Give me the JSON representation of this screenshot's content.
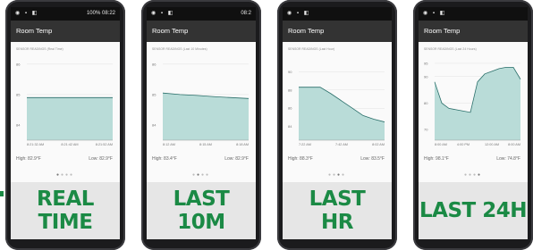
{
  "accent_color": "#1b8a45",
  "fill_color": "#b9dcd8",
  "phones": [
    {
      "status_right": "100% 08:22",
      "app_title": "Room Temp",
      "sensor_label": "SENSOR READINGS (Real Time)",
      "high": "High: 82.9°F",
      "low": "Low: 82.9°F",
      "caption": [
        "REAL",
        "TIME"
      ],
      "active_dot": 0,
      "chart_data": {
        "type": "area",
        "x_ticks": [
          "8:21:32 AM",
          "8:21:42 AM",
          "8:21:52 AM"
        ],
        "y_ticks": [
          84,
          85,
          86
        ],
        "ylim": [
          83.5,
          86.2
        ],
        "points": [
          [
            0,
            84.9
          ],
          [
            1,
            84.9
          ],
          [
            2,
            84.9
          ],
          [
            3,
            84.9
          ],
          [
            4,
            84.9
          ],
          [
            5,
            84.9
          ]
        ]
      }
    },
    {
      "status_right": "08:2",
      "app_title": "Room Temp",
      "sensor_label": "SENSOR READINGS (Last 10 Minutes)",
      "high": "High: 83.4°F",
      "low": "Low: 82.9°F",
      "caption": [
        "LAST",
        "10M"
      ],
      "active_dot": 1,
      "chart_data": {
        "type": "area",
        "x_ticks": [
          "8:12 AM",
          "8:15 AM",
          "8:18 AM"
        ],
        "y_ticks": [
          84,
          85,
          86
        ],
        "ylim": [
          83.5,
          86.2
        ],
        "points": [
          [
            0,
            85.05
          ],
          [
            1,
            85.0
          ],
          [
            2,
            84.97
          ],
          [
            3,
            84.93
          ],
          [
            4,
            84.9
          ],
          [
            5,
            84.87
          ]
        ]
      }
    },
    {
      "status_right": "",
      "app_title": "Room Temp",
      "sensor_label": "SENSOR READINGS (Last Hour)",
      "high": "High: 88.3°F",
      "low": "Low: 83.5°F",
      "caption": [
        "LAST",
        "HR"
      ],
      "active_dot": 2,
      "chart_data": {
        "type": "area",
        "x_ticks": [
          "7:22 AM",
          "7:42 AM",
          "8:02 AM"
        ],
        "y_ticks": [
          84,
          86,
          88,
          90
        ],
        "ylim": [
          82.5,
          91.5
        ],
        "points": [
          [
            0,
            88.3
          ],
          [
            1,
            88.3
          ],
          [
            2,
            88.3
          ],
          [
            3,
            87.6
          ],
          [
            4,
            86.8
          ],
          [
            5,
            86.0
          ],
          [
            6,
            85.2
          ],
          [
            7,
            84.8
          ],
          [
            8,
            84.5
          ]
        ]
      }
    },
    {
      "status_right": "",
      "app_title": "Room Temp",
      "sensor_label": "SENSOR READINGS (Last 24 Hours)",
      "high": "High: 98.1°F",
      "low": "Low: 74.8°F",
      "caption": [
        "LAST 24H"
      ],
      "active_dot": 3,
      "chart_data": {
        "type": "area",
        "x_ticks": [
          "8:00 AM",
          "4:00 PM",
          "12:00 AM",
          "8:00 AM"
        ],
        "y_ticks": [
          70,
          80,
          90,
          95
        ],
        "ylim": [
          66,
          97
        ],
        "points": [
          [
            0,
            88
          ],
          [
            1,
            80
          ],
          [
            2,
            78
          ],
          [
            3,
            77.5
          ],
          [
            4,
            77
          ],
          [
            5,
            76.5
          ],
          [
            6,
            88
          ],
          [
            7,
            91
          ],
          [
            8,
            92
          ],
          [
            9,
            93
          ],
          [
            10,
            93.5
          ],
          [
            11,
            93.5
          ],
          [
            12,
            89
          ]
        ]
      }
    }
  ]
}
